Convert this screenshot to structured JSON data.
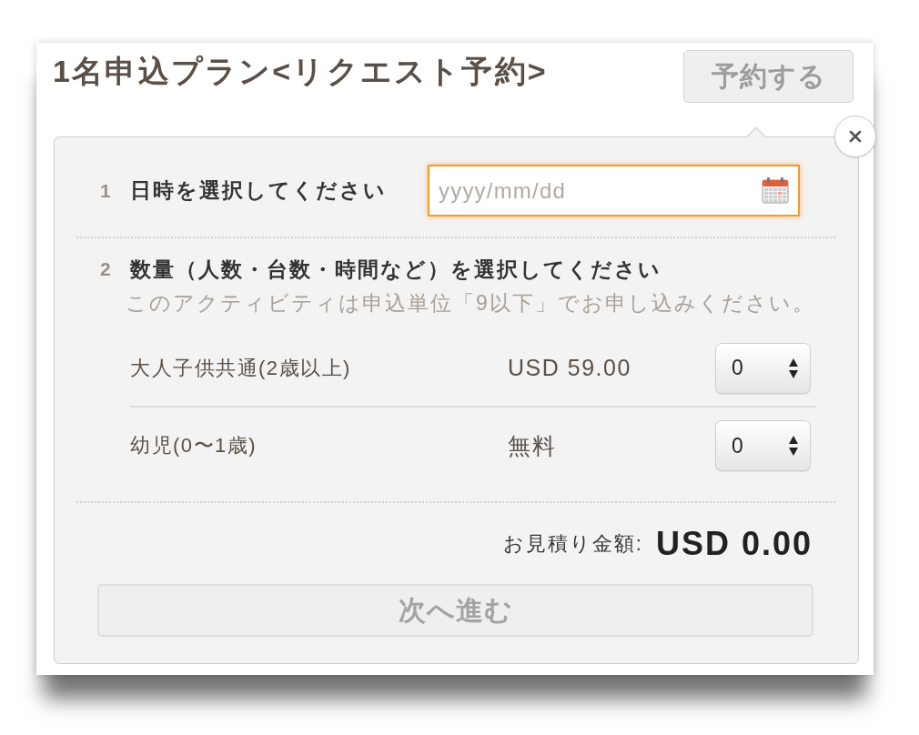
{
  "title": "1名申込プラン<リクエスト予約>",
  "reserve_button": {
    "label": "予約する",
    "disabled": true
  },
  "step_1": {
    "number": "1",
    "label": "日時を選択してください",
    "date_field": {
      "placeholder": "yyyy/mm/dd",
      "focused": true
    }
  },
  "step_2": {
    "number": "2",
    "label": "数量（人数・台数・時間など）を選択してください",
    "note": "このアクティビティは申込単位「9以下」でお申し込みください。",
    "items": [
      {
        "name": "大人子供共通(2歳以上)",
        "price": "USD 59.00",
        "quantity": "0"
      },
      {
        "name": "幼児(0〜1歳)",
        "price": "無料",
        "quantity": "0"
      }
    ]
  },
  "estimate": {
    "label": "お見積り金額:",
    "amount": "USD 0.00"
  },
  "next_button": {
    "label": "次へ進む",
    "disabled": true
  }
}
